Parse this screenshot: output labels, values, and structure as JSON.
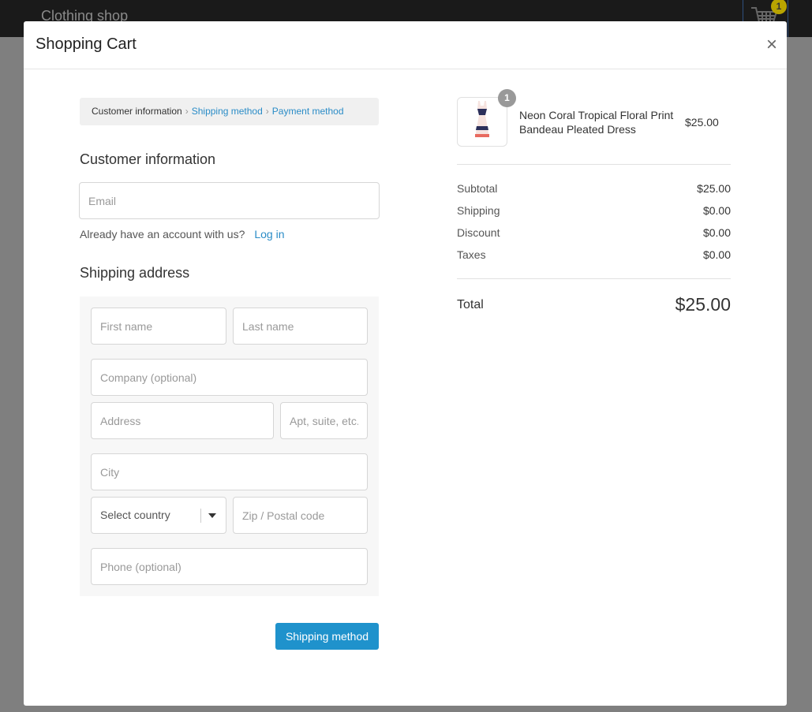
{
  "background": {
    "shop_title": "Clothing shop",
    "cart_count": "1"
  },
  "modal": {
    "title": "Shopping Cart",
    "close_label": "×"
  },
  "breadcrumb": {
    "current": "Customer information",
    "step2": "Shipping method",
    "step3": "Payment method",
    "separator": "›"
  },
  "customer": {
    "heading": "Customer information",
    "email_placeholder": "Email",
    "account_prompt": "Already have an account with us?",
    "login_label": "Log in"
  },
  "shipping": {
    "heading": "Shipping address",
    "first_name_placeholder": "First name",
    "last_name_placeholder": "Last name",
    "company_placeholder": "Company (optional)",
    "address_placeholder": "Address",
    "apt_placeholder": "Apt, suite, etc.",
    "city_placeholder": "City",
    "country_selected": "Select country",
    "zip_placeholder": "Zip / Postal code",
    "phone_placeholder": "Phone (optional)",
    "submit_label": "Shipping method"
  },
  "order": {
    "item": {
      "name": "Neon Coral Tropical Floral Print Bandeau Pleated Dress",
      "price": "$25.00",
      "quantity": "1"
    },
    "summary": [
      {
        "label": "Subtotal",
        "value": "$25.00"
      },
      {
        "label": "Shipping",
        "value": "$0.00"
      },
      {
        "label": "Discount",
        "value": "$0.00"
      },
      {
        "label": "Taxes",
        "value": "$0.00"
      }
    ],
    "total_label": "Total",
    "total_value": "$25.00"
  },
  "colors": {
    "accent": "#1f92cc",
    "link": "#2a8cc7",
    "overlay": "#7f7f7f",
    "topbar": "#1a1a1a"
  }
}
